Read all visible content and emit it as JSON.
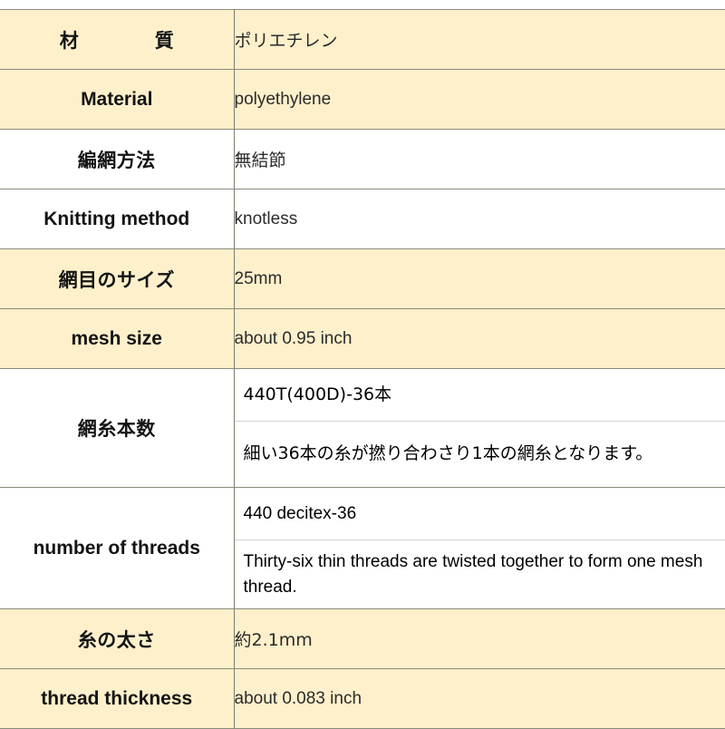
{
  "document": {
    "kind": "product-specification-table",
    "background_color": "#ffffff",
    "row_highlight_color": "#fdf0cb",
    "row_plain_color": "#ffffff",
    "border_color": "#8a8a7a",
    "inner_divider_color": "#d2d2d2",
    "text_color": "#141414"
  },
  "table": {
    "columns": [
      "label",
      "value"
    ],
    "rows": [
      {
        "id": "material-ja",
        "highlight": true,
        "label": "材　　質",
        "label_lang": "ja",
        "label_spaced": true,
        "values": [
          "ポリエチレン"
        ],
        "value_lang": "ja"
      },
      {
        "id": "material-en",
        "highlight": true,
        "label": "Material",
        "label_lang": "en",
        "label_spaced": false,
        "values": [
          "polyethylene"
        ],
        "value_lang": "en"
      },
      {
        "id": "knitting-method-ja",
        "highlight": false,
        "label": "編網方法",
        "label_lang": "ja",
        "label_spaced": false,
        "values": [
          "無結節"
        ],
        "value_lang": "ja"
      },
      {
        "id": "knitting-method-en",
        "highlight": false,
        "label": "Knitting method",
        "label_lang": "en",
        "label_spaced": false,
        "values": [
          "knotless"
        ],
        "value_lang": "en"
      },
      {
        "id": "mesh-size-ja",
        "highlight": true,
        "label": "網目のサイズ",
        "label_lang": "ja",
        "label_spaced": false,
        "values": [
          "25mm"
        ],
        "value_lang": "en"
      },
      {
        "id": "mesh-size-en",
        "highlight": true,
        "label": "mesh size",
        "label_lang": "en",
        "label_spaced": false,
        "values": [
          "about 0.95 inch"
        ],
        "value_lang": "en"
      },
      {
        "id": "number-of-threads-ja",
        "highlight": false,
        "label": "網糸本数",
        "label_lang": "ja",
        "label_spaced": false,
        "values": [
          "440T(400D)-36本",
          "細い36本の糸が撚り合わさり1本の網糸となります。"
        ],
        "value_lang": "ja"
      },
      {
        "id": "number-of-threads-en",
        "highlight": false,
        "label": "number of threads",
        "label_lang": "en",
        "label_spaced": false,
        "values": [
          "440 decitex-36",
          "Thirty-six thin threads are twisted together to form one mesh thread."
        ],
        "value_lang": "en"
      },
      {
        "id": "thread-thickness-ja",
        "highlight": true,
        "label": "糸の太さ",
        "label_lang": "ja",
        "label_spaced": false,
        "values": [
          "約2.1mm"
        ],
        "value_lang": "ja"
      },
      {
        "id": "thread-thickness-en",
        "highlight": true,
        "label": "thread thickness",
        "label_lang": "en",
        "label_spaced": false,
        "values": [
          "about 0.083 inch"
        ],
        "value_lang": "en"
      }
    ]
  }
}
